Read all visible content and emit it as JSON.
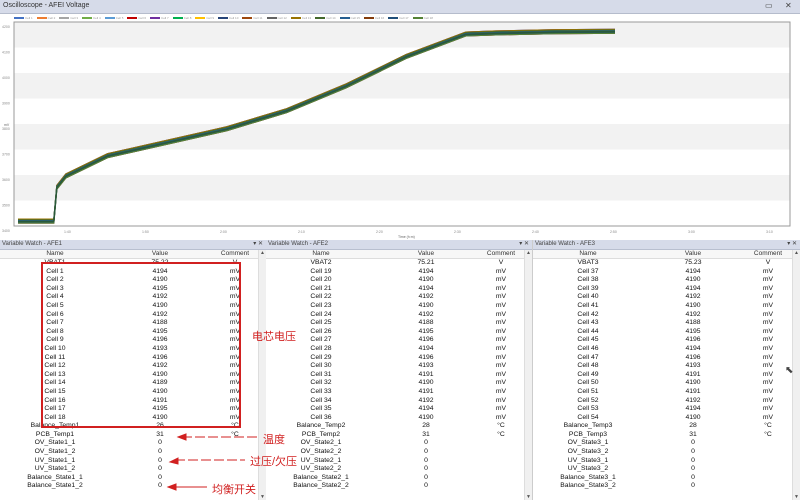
{
  "oscilloscope": {
    "title": "Oscilloscope - AFEI Voltage",
    "legend": [
      "Cell 1",
      "Cell 2",
      "Cell 3",
      "Cell 4",
      "Cell 5",
      "Cell 6",
      "Cell 7",
      "Cell 8",
      "Cell 9",
      "Cell 10",
      "Cell 11",
      "Cell 12",
      "Cell 13",
      "Cell 14",
      "Cell 15",
      "Cell 16",
      "Cell 17",
      "Cell 18"
    ],
    "legend_colors": [
      "#4472c4",
      "#ed7d31",
      "#a5a5a5",
      "#70ad47",
      "#5b9bd5",
      "#c00000",
      "#7030a0",
      "#00b050",
      "#ffc000",
      "#264478",
      "#9e480e",
      "#636363",
      "#997300",
      "#43682b",
      "#255e91",
      "#843c0c",
      "#1f4e79",
      "#548235"
    ],
    "xlabel": "Time (h:m)",
    "ylabel": "mV",
    "x_ticks": [
      "1:40",
      "1:50",
      "2:00",
      "2:10",
      "2:20",
      "2:30",
      "2:40",
      "2:50",
      "3:00",
      "3:10"
    ],
    "y_ticks": [
      "4200",
      "4100",
      "4000",
      "3900",
      "3800",
      "3700",
      "3600",
      "3500",
      "3400"
    ]
  },
  "chart_data": {
    "type": "line",
    "title": "Oscilloscope - AFEI Voltage",
    "xlabel": "Time (h:m)",
    "ylabel": "mV",
    "ylim": [
      3330,
      4235
    ],
    "x": [
      0,
      0.06,
      0.065,
      0.08,
      0.15,
      0.25,
      0.35,
      0.45,
      0.55,
      0.65,
      0.75,
      0.8,
      0.9,
      1.0
    ],
    "y": [
      3350,
      3350,
      3500,
      3550,
      3640,
      3700,
      3760,
      3840,
      3950,
      4080,
      4180,
      4185,
      4190,
      4192
    ],
    "series_count": 18,
    "grid": true
  },
  "panels": [
    {
      "title": "Variable Watch - AFE1",
      "headers": {
        "name": "Name",
        "value": "Value",
        "comment": "Comment"
      },
      "rows": [
        {
          "name": "VBAT1",
          "value": "75.22",
          "comment": "V"
        },
        {
          "name": "Cell 1",
          "value": "4194",
          "comment": "mV"
        },
        {
          "name": "Cell 2",
          "value": "4190",
          "comment": "mV"
        },
        {
          "name": "Cell 3",
          "value": "4195",
          "comment": "mV"
        },
        {
          "name": "Cell 4",
          "value": "4192",
          "comment": "mV"
        },
        {
          "name": "Cell 5",
          "value": "4190",
          "comment": "mV"
        },
        {
          "name": "Cell 6",
          "value": "4192",
          "comment": "mV"
        },
        {
          "name": "Cell 7",
          "value": "4188",
          "comment": "mV"
        },
        {
          "name": "Cell 8",
          "value": "4195",
          "comment": "mV"
        },
        {
          "name": "Cell 9",
          "value": "4196",
          "comment": "mV"
        },
        {
          "name": "Cell 10",
          "value": "4193",
          "comment": "mV"
        },
        {
          "name": "Cell 11",
          "value": "4196",
          "comment": "mV"
        },
        {
          "name": "Cell 12",
          "value": "4192",
          "comment": "mV"
        },
        {
          "name": "Cell 13",
          "value": "4190",
          "comment": "mV"
        },
        {
          "name": "Cell 14",
          "value": "4189",
          "comment": "mV"
        },
        {
          "name": "Cell 15",
          "value": "4190",
          "comment": "mV"
        },
        {
          "name": "Cell 16",
          "value": "4191",
          "comment": "mV"
        },
        {
          "name": "Cell 17",
          "value": "4195",
          "comment": "mV"
        },
        {
          "name": "Cell 18",
          "value": "4190",
          "comment": "mV"
        },
        {
          "name": "Balance_Temp1",
          "value": "26",
          "comment": "°C"
        },
        {
          "name": "PCB_Temp1",
          "value": "31",
          "comment": "°C"
        },
        {
          "name": "OV_State1_1",
          "value": "0",
          "comment": ""
        },
        {
          "name": "OV_State1_2",
          "value": "0",
          "comment": ""
        },
        {
          "name": "UV_State1_1",
          "value": "0",
          "comment": ""
        },
        {
          "name": "UV_State1_2",
          "value": "0",
          "comment": ""
        },
        {
          "name": "Balance_State1_1",
          "value": "0",
          "comment": ""
        },
        {
          "name": "Balance_State1_2",
          "value": "0",
          "comment": ""
        }
      ]
    },
    {
      "title": "Variable Watch - AFE2",
      "headers": {
        "name": "Name",
        "value": "Value",
        "comment": "Comment"
      },
      "rows": [
        {
          "name": "VBAT2",
          "value": "75.21",
          "comment": "V"
        },
        {
          "name": "Cell 19",
          "value": "4194",
          "comment": "mV"
        },
        {
          "name": "Cell 20",
          "value": "4190",
          "comment": "mV"
        },
        {
          "name": "Cell 21",
          "value": "4194",
          "comment": "mV"
        },
        {
          "name": "Cell 22",
          "value": "4192",
          "comment": "mV"
        },
        {
          "name": "Cell 23",
          "value": "4190",
          "comment": "mV"
        },
        {
          "name": "Cell 24",
          "value": "4192",
          "comment": "mV"
        },
        {
          "name": "Cell 25",
          "value": "4188",
          "comment": "mV"
        },
        {
          "name": "Cell 26",
          "value": "4195",
          "comment": "mV"
        },
        {
          "name": "Cell 27",
          "value": "4196",
          "comment": "mV"
        },
        {
          "name": "Cell 28",
          "value": "4194",
          "comment": "mV"
        },
        {
          "name": "Cell 29",
          "value": "4196",
          "comment": "mV"
        },
        {
          "name": "Cell 30",
          "value": "4193",
          "comment": "mV"
        },
        {
          "name": "Cell 31",
          "value": "4191",
          "comment": "mV"
        },
        {
          "name": "Cell 32",
          "value": "4190",
          "comment": "mV"
        },
        {
          "name": "Cell 33",
          "value": "4191",
          "comment": "mV"
        },
        {
          "name": "Cell 34",
          "value": "4192",
          "comment": "mV"
        },
        {
          "name": "Cell 35",
          "value": "4194",
          "comment": "mV"
        },
        {
          "name": "Cell 36",
          "value": "4190",
          "comment": "mV"
        },
        {
          "name": "Balance_Temp2",
          "value": "28",
          "comment": "°C"
        },
        {
          "name": "PCB_Temp2",
          "value": "31",
          "comment": "°C"
        },
        {
          "name": "OV_State2_1",
          "value": "0",
          "comment": ""
        },
        {
          "name": "OV_State2_2",
          "value": "0",
          "comment": ""
        },
        {
          "name": "UV_State2_1",
          "value": "0",
          "comment": ""
        },
        {
          "name": "UV_State2_2",
          "value": "0",
          "comment": ""
        },
        {
          "name": "Balance_State2_1",
          "value": "0",
          "comment": ""
        },
        {
          "name": "Balance_State2_2",
          "value": "0",
          "comment": ""
        }
      ]
    },
    {
      "title": "Variable Watch - AFE3",
      "headers": {
        "name": "Name",
        "value": "Value",
        "comment": "Comment"
      },
      "rows": [
        {
          "name": "VBAT3",
          "value": "75.23",
          "comment": "V"
        },
        {
          "name": "Cell 37",
          "value": "4194",
          "comment": "mV"
        },
        {
          "name": "Cell 38",
          "value": "4190",
          "comment": "mV"
        },
        {
          "name": "Cell 39",
          "value": "4194",
          "comment": "mV"
        },
        {
          "name": "Cell 40",
          "value": "4192",
          "comment": "mV"
        },
        {
          "name": "Cell 41",
          "value": "4190",
          "comment": "mV"
        },
        {
          "name": "Cell 42",
          "value": "4192",
          "comment": "mV"
        },
        {
          "name": "Cell 43",
          "value": "4188",
          "comment": "mV"
        },
        {
          "name": "Cell 44",
          "value": "4195",
          "comment": "mV"
        },
        {
          "name": "Cell 45",
          "value": "4196",
          "comment": "mV"
        },
        {
          "name": "Cell 46",
          "value": "4194",
          "comment": "mV"
        },
        {
          "name": "Cell 47",
          "value": "4196",
          "comment": "mV"
        },
        {
          "name": "Cell 48",
          "value": "4193",
          "comment": "mV"
        },
        {
          "name": "Cell 49",
          "value": "4191",
          "comment": "mV"
        },
        {
          "name": "Cell 50",
          "value": "4190",
          "comment": "mV"
        },
        {
          "name": "Cell 51",
          "value": "4191",
          "comment": "mV"
        },
        {
          "name": "Cell 52",
          "value": "4192",
          "comment": "mV"
        },
        {
          "name": "Cell 53",
          "value": "4194",
          "comment": "mV"
        },
        {
          "name": "Cell 54",
          "value": "4190",
          "comment": "mV"
        },
        {
          "name": "Balance_Temp3",
          "value": "28",
          "comment": "°C"
        },
        {
          "name": "PCB_Temp3",
          "value": "31",
          "comment": "°C"
        },
        {
          "name": "OV_State3_1",
          "value": "0",
          "comment": ""
        },
        {
          "name": "OV_State3_2",
          "value": "0",
          "comment": ""
        },
        {
          "name": "UV_State3_1",
          "value": "0",
          "comment": ""
        },
        {
          "name": "UV_State3_2",
          "value": "0",
          "comment": ""
        },
        {
          "name": "Balance_State3_1",
          "value": "0",
          "comment": ""
        },
        {
          "name": "Balance_State3_2",
          "value": "0",
          "comment": ""
        }
      ]
    }
  ],
  "annotations": {
    "cell_voltage": "电芯电压",
    "temperature": "温度",
    "ov_uv": "过压/欠压",
    "balance_switch": "均衡开关",
    "accent_color": "#d12020"
  },
  "icons": {
    "panel_controls": "▾ ✕",
    "window_controls": "▭ ✕",
    "scroll_up": "▲",
    "scroll_down": "▼"
  }
}
